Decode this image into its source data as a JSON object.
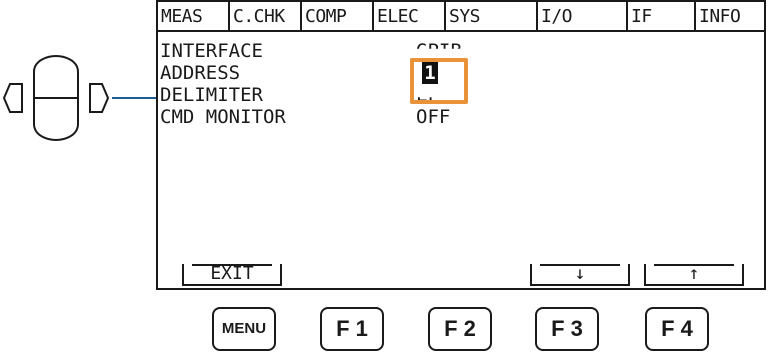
{
  "tabs": [
    "MEAS",
    "C.CHK",
    "COMP",
    "ELEC",
    "SYS",
    "I/O",
    "IF",
    "INFO"
  ],
  "settings": [
    {
      "label": "INTERFACE",
      "value": "GPIB"
    },
    {
      "label": "ADDRESS",
      "value": "1"
    },
    {
      "label": "DELIMITER",
      "value": "LF"
    },
    {
      "label": "CMD MONITOR",
      "value": "OFF"
    }
  ],
  "softkeys": {
    "exit": "EXIT",
    "down": "↓",
    "up": "↑"
  },
  "hardware_keys": {
    "menu": "MENU",
    "f1": "F 1",
    "f2": "F 2",
    "f3": "F 3",
    "f4": "F 4"
  },
  "colors": {
    "highlight": "#e8923a",
    "leader": "#1f5d95"
  },
  "icons": {
    "cursor_keys": "dpad-icon"
  }
}
